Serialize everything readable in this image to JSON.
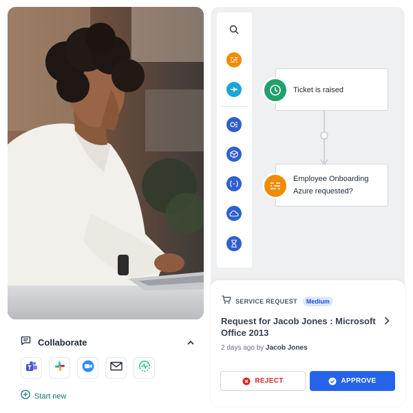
{
  "collaborate": {
    "title": "Collaborate",
    "apps": [
      {
        "icon": "teams-icon",
        "color": "#5059c9"
      },
      {
        "icon": "slack-icon",
        "color": "#e01e5a"
      },
      {
        "icon": "zoom-icon",
        "color": "#2d8cff"
      },
      {
        "icon": "mail-icon",
        "color": "#374151"
      },
      {
        "icon": "webex-icon",
        "color": "#10b981"
      }
    ],
    "start_new": "Start new"
  },
  "workflow": {
    "rail_icons": [
      "search-icon",
      "filter-icon",
      "arrow-icon",
      "queue-icon",
      "box-icon",
      "code-icon",
      "cloud-icon",
      "hourglass-icon"
    ],
    "nodes": [
      {
        "lines": [
          "Ticket is raised"
        ],
        "icon": "clock-icon",
        "color": "#22a06b"
      },
      {
        "lines": [
          "Employee Onboarding",
          "Azure requested?"
        ],
        "icon": "filter-icon",
        "color": "#f08c00"
      }
    ]
  },
  "request": {
    "type_label": "SERVICE REQUEST",
    "priority": "Medium",
    "title": "Request for Jacob Jones : Microsoft Office 2013",
    "age": "2 days ago by",
    "requester": "Jacob Jones",
    "reject_label": "REJECT",
    "approve_label": "APPROVE"
  },
  "colors": {
    "accent": "#2563eb",
    "reject": "#dc2626",
    "orange": "#f08c00",
    "cyan": "#1aa7d6",
    "blue": "#2f5fd0",
    "green": "#22a06b"
  }
}
